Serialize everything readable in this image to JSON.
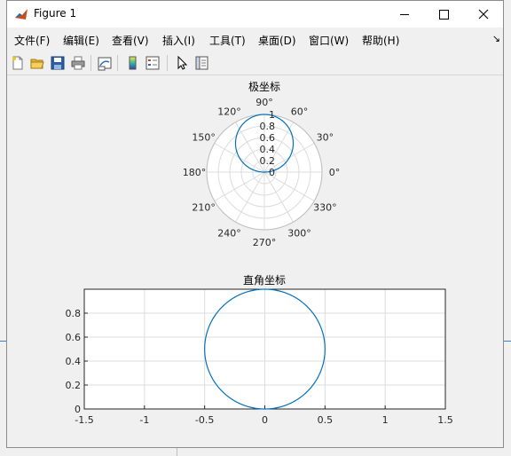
{
  "window": {
    "title": "Figure 1"
  },
  "menu": {
    "items": [
      "文件(F)",
      "编辑(E)",
      "查看(V)",
      "插入(I)",
      "工具(T)",
      "桌面(D)",
      "窗口(W)",
      "帮助(H)"
    ],
    "extra": "↘"
  },
  "toolbar": {
    "icons": [
      "new-figure-icon",
      "open-file-icon",
      "save-icon",
      "print-icon",
      "link-plot-icon",
      "colorbar-icon",
      "legend-icon",
      "pointer-icon",
      "property-inspector-icon"
    ]
  },
  "polar": {
    "title": "极坐标",
    "angle_labels": [
      "0°",
      "30°",
      "60°",
      "90°",
      "120°",
      "150°",
      "180°",
      "210°",
      "240°",
      "270°",
      "300°",
      "330°"
    ],
    "r_labels": [
      "0",
      "0.2",
      "0.4",
      "0.6",
      "0.8",
      "1"
    ]
  },
  "cartesian": {
    "title": "直角坐标",
    "x_ticks": [
      "-1.5",
      "-1",
      "-0.5",
      "0",
      "0.5",
      "1",
      "1.5"
    ],
    "y_ticks": [
      "0",
      "0.2",
      "0.4",
      "0.6",
      "0.8"
    ]
  },
  "chart_data": [
    {
      "type": "line",
      "projection": "polar",
      "title": "极坐标",
      "series": [
        {
          "equation": "r = sin(theta)",
          "color": "#0072bd"
        }
      ],
      "theta_ticks_deg": [
        0,
        30,
        60,
        90,
        120,
        150,
        180,
        210,
        240,
        270,
        300,
        330
      ],
      "r_ticks": [
        0,
        0.2,
        0.4,
        0.6,
        0.8,
        1
      ],
      "rlim": [
        0,
        1
      ],
      "grid": true
    },
    {
      "type": "line",
      "title": "直角坐标",
      "series": [
        {
          "equation": "x = 0.5*cos(t), y = 0.5 + 0.5*sin(t)",
          "shape": "circle",
          "center": [
            0,
            0.5
          ],
          "radius": 0.5,
          "color": "#0072bd"
        }
      ],
      "xlim": [
        -1.5,
        1.5
      ],
      "ylim": [
        0,
        1
      ],
      "x_ticks": [
        -1.5,
        -1,
        -0.5,
        0,
        0.5,
        1,
        1.5
      ],
      "y_ticks": [
        0,
        0.2,
        0.4,
        0.6,
        0.8
      ],
      "grid": true
    }
  ],
  "colors": {
    "line": "#0072bd",
    "grid": "#dcdcdc",
    "axes_bg": "#ffffff",
    "figure_bg": "#f0f0f0"
  }
}
